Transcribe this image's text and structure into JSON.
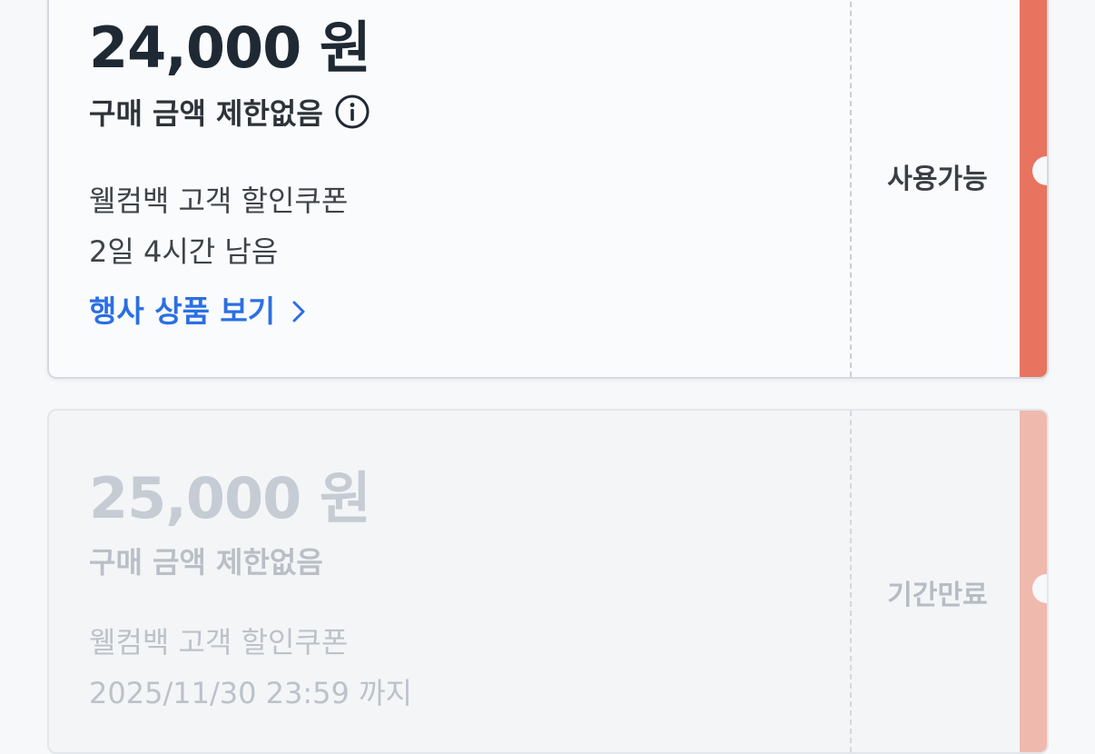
{
  "coupons": [
    {
      "amount": "24,000 원",
      "limit": "구매 금액 제한없음",
      "name": "웰컴백 고객 할인쿠폰",
      "expiry": "2일 4시간 남음",
      "link_label": "행사 상품 보기",
      "status": "사용가능",
      "accent_color": "#e8735f",
      "link_color": "#2b6fe3",
      "info_icon": "info-circle-icon",
      "link_icon": "chevron-right-icon"
    },
    {
      "amount": "25,000 원",
      "limit": "구매 금액 제한없음",
      "name": "웰컴백 고객 할인쿠폰",
      "expiry": "2025/11/30 23:59 까지",
      "status": "기간만료",
      "accent_color": "#efb9ad"
    }
  ]
}
